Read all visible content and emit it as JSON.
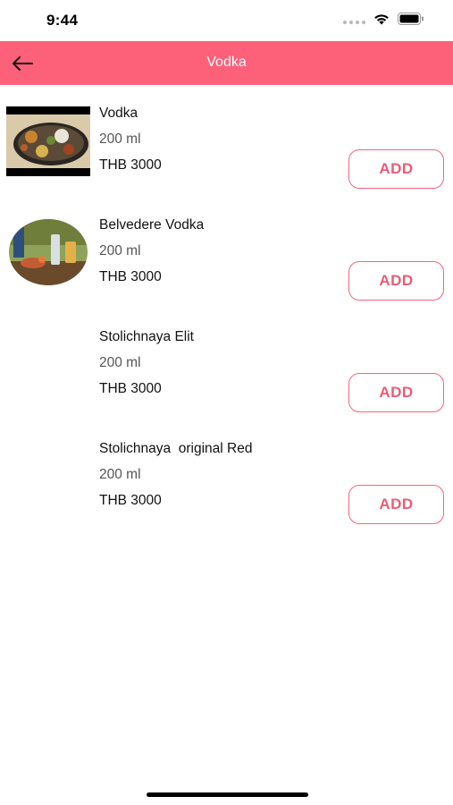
{
  "status_bar": {
    "time": "9:44"
  },
  "header": {
    "title": "Vodka",
    "back_icon": "arrow-left-icon"
  },
  "products": [
    {
      "name": "Vodka",
      "size": "200 ml",
      "price": "THB 3000",
      "add_label": "ADD",
      "thumbnail": "food-platter-photo"
    },
    {
      "name": "Belvedere Vodka",
      "size": "200 ml",
      "price": "THB 3000",
      "add_label": "ADD",
      "thumbnail": "drinks-table-photo"
    },
    {
      "name": "Stolichnaya Elit",
      "size": "200 ml",
      "price": "THB 3000",
      "add_label": "ADD",
      "thumbnail": ""
    },
    {
      "name": "Stolichnaya  original Red",
      "size": "200 ml",
      "price": "THB 3000",
      "add_label": "ADD",
      "thumbnail": ""
    }
  ],
  "colors": {
    "accent": "#fd6079",
    "button_border": "#f4637c",
    "button_text": "#ef5b75"
  }
}
